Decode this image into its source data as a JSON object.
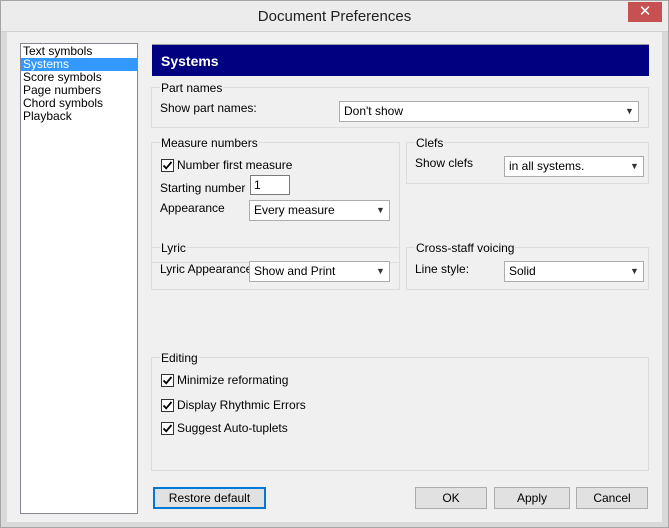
{
  "window": {
    "title": "Document Preferences",
    "close_glyph": "✕"
  },
  "nav": {
    "items": [
      {
        "label": "Text symbols",
        "selected": false
      },
      {
        "label": "Systems",
        "selected": true
      },
      {
        "label": "Score symbols",
        "selected": false
      },
      {
        "label": "Page numbers",
        "selected": false
      },
      {
        "label": "Chord symbols",
        "selected": false
      },
      {
        "label": "Playback",
        "selected": false
      }
    ]
  },
  "header": {
    "title": "Systems"
  },
  "part_names": {
    "title": "Part names",
    "show_label": "Show part names:",
    "show_value": "Don't show"
  },
  "measure_numbers": {
    "title": "Measure numbers",
    "number_first": {
      "label": "Number first measure",
      "checked": true
    },
    "starting_label": "Starting number",
    "starting_value": "1",
    "appearance_label": "Appearance",
    "appearance_value": "Every measure"
  },
  "clefs": {
    "title": "Clefs",
    "show_label": "Show clefs",
    "show_value": "in all systems."
  },
  "lyric": {
    "title": "Lyric",
    "appearance_label": "Lyric Appearance",
    "appearance_value": "Show and Print"
  },
  "cross_staff": {
    "title": "Cross-staff voicing",
    "line_label": "Line style:",
    "line_value": "Solid"
  },
  "editing": {
    "title": "Editing",
    "options": [
      {
        "label": "Minimize reformating",
        "checked": true
      },
      {
        "label": "Display Rhythmic Errors",
        "checked": true
      },
      {
        "label": "Suggest Auto-tuplets",
        "checked": true
      }
    ]
  },
  "buttons": {
    "restore": "Restore default",
    "ok": "OK",
    "apply": "Apply",
    "cancel": "Cancel"
  },
  "colors": {
    "header_bg": "#000080",
    "selection_bg": "#3399ff",
    "close_bg": "#c75050"
  }
}
